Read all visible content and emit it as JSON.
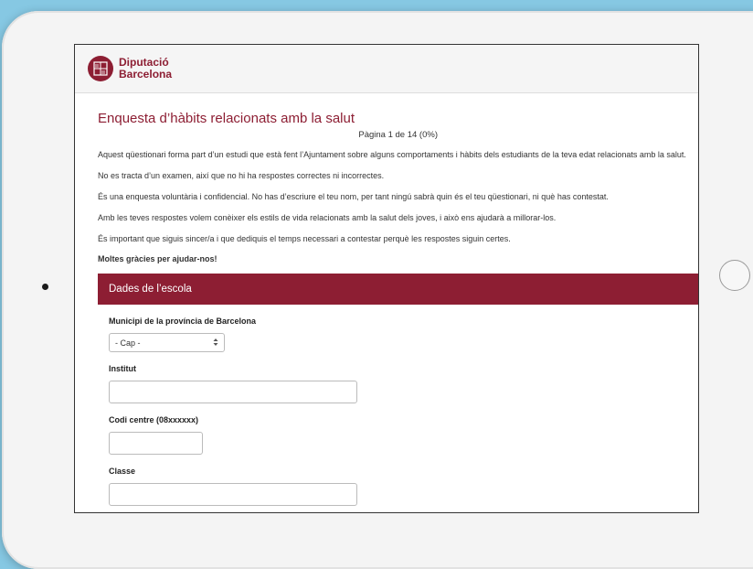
{
  "header": {
    "logo_line1": "Diputació",
    "logo_line2": "Barcelona"
  },
  "survey": {
    "title": "Enquesta d’hàbits relacionats amb la salut",
    "page_indicator": "Pàgina 1 de 14 (0%)",
    "paragraphs": [
      "Aquest qüestionari forma part d’un estudi que està fent l’Ajuntament sobre alguns comportaments i hàbits dels estudiants de la teva edat relacionats amb la salut.",
      "No es tracta d’un examen, així que no hi ha respostes correctes ni incorrectes.",
      "És una enquesta voluntària i confidencial. No has d’escriure el teu nom, per tant ningú sabrà quin és el teu qüestionari, ni què has contestat.",
      "Amb les teves respostes volem conèixer els estils de vida relacionats amb la salut dels joves, i això ens ajudarà a millorar-los.",
      "És important que siguis sincer/a i que dediquis el temps necessari a contestar perquè les respostes siguin certes."
    ],
    "thanks": "Moltes gràcies per ajudar-nos!"
  },
  "section": {
    "title": "Dades de l’escola",
    "fields": {
      "municipi_label": "Municipi de la província de Barcelona",
      "municipi_value": "- Cap -",
      "institut_label": "Institut",
      "institut_value": "",
      "codi_label": "Codi centre (08xxxxxx)",
      "codi_value": "",
      "classe_label": "Classe",
      "classe_value": ""
    }
  },
  "colors": {
    "brand": "#8d1e33",
    "background": "#86c8e3"
  },
  "icons": {
    "select_arrow": "updown-chevron-icon",
    "logo": "diputacio-seal-icon"
  }
}
